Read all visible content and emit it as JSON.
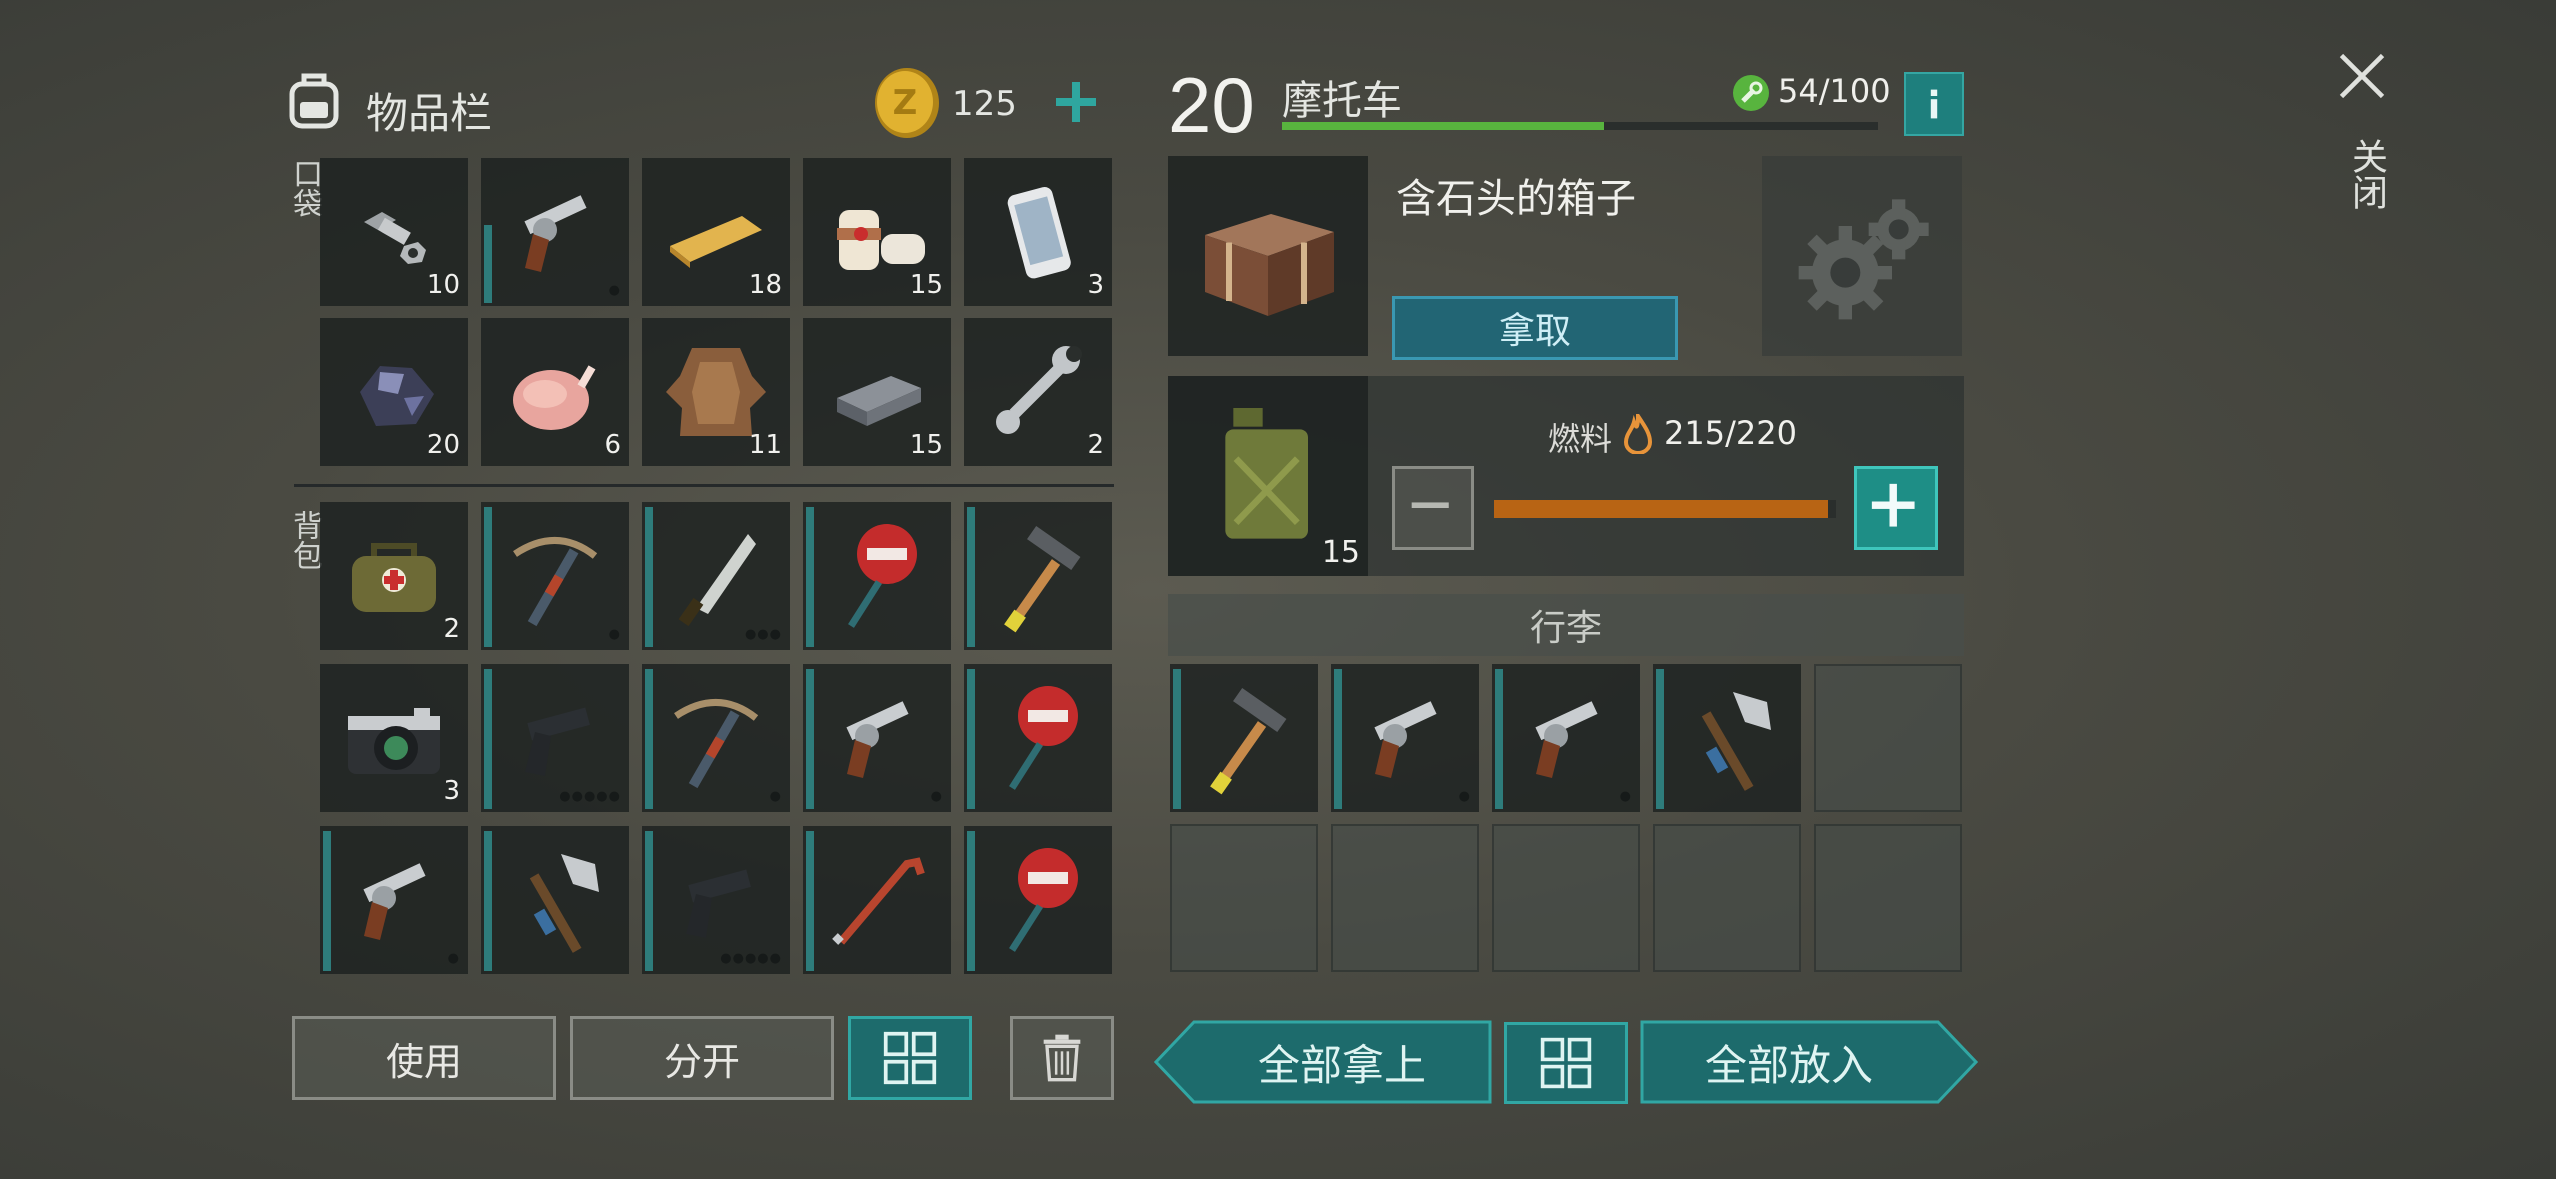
{
  "inventory": {
    "title": "物品栏",
    "coins": "125",
    "pocket_label": "口袋",
    "backpack_label": "背包",
    "pocket": [
      {
        "name": "bolt-and-nut",
        "count": "10"
      },
      {
        "name": "revolver",
        "count": ""
      },
      {
        "name": "wood-plank",
        "count": "18"
      },
      {
        "name": "bandage",
        "count": "15"
      },
      {
        "name": "smartphone",
        "count": "3"
      },
      {
        "name": "ore",
        "count": "20"
      },
      {
        "name": "raw-chicken",
        "count": "6"
      },
      {
        "name": "animal-hide",
        "count": "11"
      },
      {
        "name": "iron-ingot",
        "count": "15"
      },
      {
        "name": "wrench",
        "count": "2"
      }
    ],
    "backpack": [
      {
        "name": "medkit-bag",
        "count": "2"
      },
      {
        "name": "crossbow",
        "count": ""
      },
      {
        "name": "machete",
        "count": ""
      },
      {
        "name": "stop-sign",
        "count": ""
      },
      {
        "name": "hammer",
        "count": ""
      },
      {
        "name": "camera",
        "count": "3"
      },
      {
        "name": "pistol",
        "count": ""
      },
      {
        "name": "crossbow",
        "count": ""
      },
      {
        "name": "revolver",
        "count": ""
      },
      {
        "name": "stop-sign",
        "count": ""
      },
      {
        "name": "revolver",
        "count": ""
      },
      {
        "name": "fire-axe",
        "count": ""
      },
      {
        "name": "pistol",
        "count": ""
      },
      {
        "name": "crowbar",
        "count": ""
      },
      {
        "name": "stop-sign",
        "count": ""
      }
    ],
    "use_label": "使用",
    "split_label": "分开"
  },
  "vehicle": {
    "level": "20",
    "name": "摩托车",
    "durability": "54/100",
    "durability_fraction": 0.54,
    "crate_title": "含石头的箱子",
    "take_label": "拿取",
    "fuel_label": "燃料",
    "fuel_value": "215/220",
    "fuel_fraction": 0.977,
    "fuel_can_count": "15",
    "luggage_label": "行李",
    "luggage": [
      "hammer",
      "revolver",
      "revolver",
      "fire-axe"
    ],
    "take_all_label": "全部拿上",
    "put_all_label": "全部放入"
  },
  "close_label": "关闭",
  "colors": {
    "accent_teal": "#1d6b6c",
    "durability_green": "#58b43e",
    "fuel_orange": "#b86414",
    "coin_gold": "#e1b230"
  }
}
